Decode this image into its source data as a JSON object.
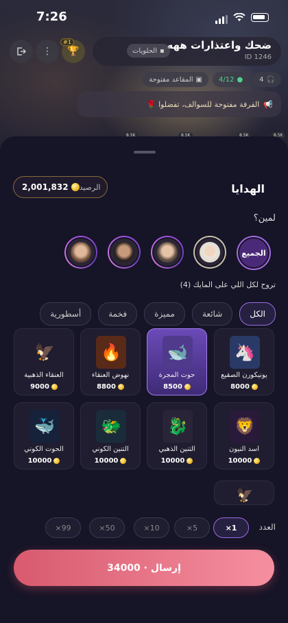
{
  "status": {
    "time": "7:26"
  },
  "room": {
    "name": "ضحك واعتذارات ههه",
    "id": "ID 1246",
    "category": "الحلويات",
    "rank_badge": "#1",
    "pills": {
      "headphones": "4",
      "mic_count": "4/12",
      "open_seats": "المقاعد مفتوحة"
    },
    "announcement": "القرفة مفتوحة للسوالف، تفضلوا 🌹",
    "mic_badges": [
      "8.5K",
      "8.5K",
      "8.5K",
      "8.5K"
    ]
  },
  "sheet": {
    "title": "الهدايا",
    "balance_label": "الرصيد",
    "balance_value": "2,001,832",
    "for_whom": "لمين؟",
    "all_label": "الجميع",
    "to_all_text": "تروح لكل اللي على المايك (4)"
  },
  "tabs": [
    "الكل",
    "شائعة",
    "مميزة",
    "فخمة",
    "أسطورية"
  ],
  "gifts": [
    {
      "name": "يونيكورن الصقيع",
      "price": "8000",
      "icon": "unicorn-icon",
      "emoji": "🦄",
      "bg": "#2a3a66"
    },
    {
      "name": "حوت المجرة",
      "price": "8500",
      "icon": "whale-icon",
      "emoji": "🐋",
      "bg": "#4f3a8c"
    },
    {
      "name": "نهوض العنقاء",
      "price": "8800",
      "icon": "phoenix-icon",
      "emoji": "🔥",
      "bg": "#5a2a18"
    },
    {
      "name": "العنقاء الذهبية",
      "price": "9000",
      "icon": "golden-phoenix-icon",
      "emoji": "🦅",
      "bg": "#1f1d2f"
    },
    {
      "name": "أسد النيون",
      "price": "10000",
      "icon": "lion-icon",
      "emoji": "🦁",
      "bg": "#2a1a3a"
    },
    {
      "name": "التنين الذهبي",
      "price": "10000",
      "icon": "dragon-icon",
      "emoji": "🐉",
      "bg": "#2a2438"
    },
    {
      "name": "التنين الكوني",
      "price": "10000",
      "icon": "cosmic-dragon-icon",
      "emoji": "🐲",
      "bg": "#1a2c3a"
    },
    {
      "name": "الحوت الكوني",
      "price": "10000",
      "icon": "cosmic-whale-icon",
      "emoji": "🐳",
      "bg": "#16213a"
    }
  ],
  "quantity": {
    "label": "العدد",
    "options": [
      "×1",
      "×5",
      "×10",
      "×50",
      "×99"
    ]
  },
  "send_label": "إرسال · 34000"
}
